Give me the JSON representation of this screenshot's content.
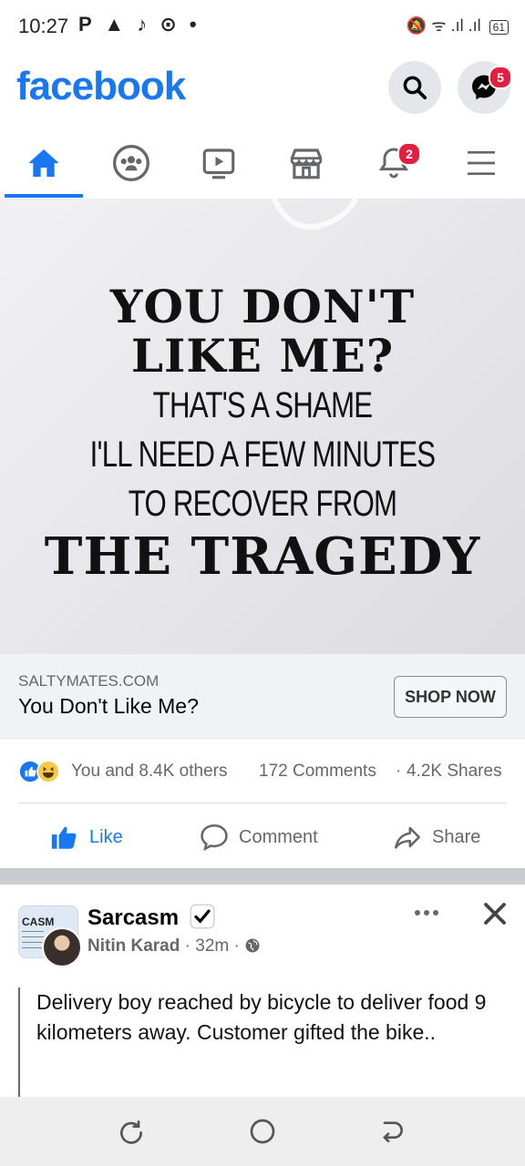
{
  "status_bar": {
    "time": "10:27",
    "left_icons": "P ▲ ♪ ⊙ •",
    "right_icons": "🔕 ᯤ .ıl .ıl ",
    "battery": "61"
  },
  "header": {
    "brand": "facebook",
    "messenger_badge": "5"
  },
  "nav": {
    "notifications_badge": "2",
    "active_tab": "home"
  },
  "post": {
    "image_text": {
      "line1": "YOU DON'T",
      "line2": "LIKE ME?",
      "line3": "THAT'S A SHAME",
      "line4": "I'LL NEED A FEW MINUTES",
      "line5": "TO RECOVER FROM",
      "line6": "THE TRAGEDY"
    },
    "ad_domain": "SALTYMATES.COM",
    "ad_title": "You Don't Like Me?",
    "shop_button": "SHOP NOW",
    "reactions_text": "You and 8.4K others",
    "comments": "172 Comments",
    "shares": "4.2K Shares",
    "actions": {
      "like": "Like",
      "comment": "Comment",
      "share": "Share"
    }
  },
  "next_post": {
    "page_name": "Sarcasm",
    "author": "Nitin Karad",
    "time": "32m",
    "avatar_text": "CASM",
    "text": "Delivery boy reached by bicycle to deliver food 9 kilometers away. Customer gifted the bike.."
  },
  "colors": {
    "brand": "#1877f2",
    "badge": "#e41e3f",
    "muted": "#65676b"
  }
}
